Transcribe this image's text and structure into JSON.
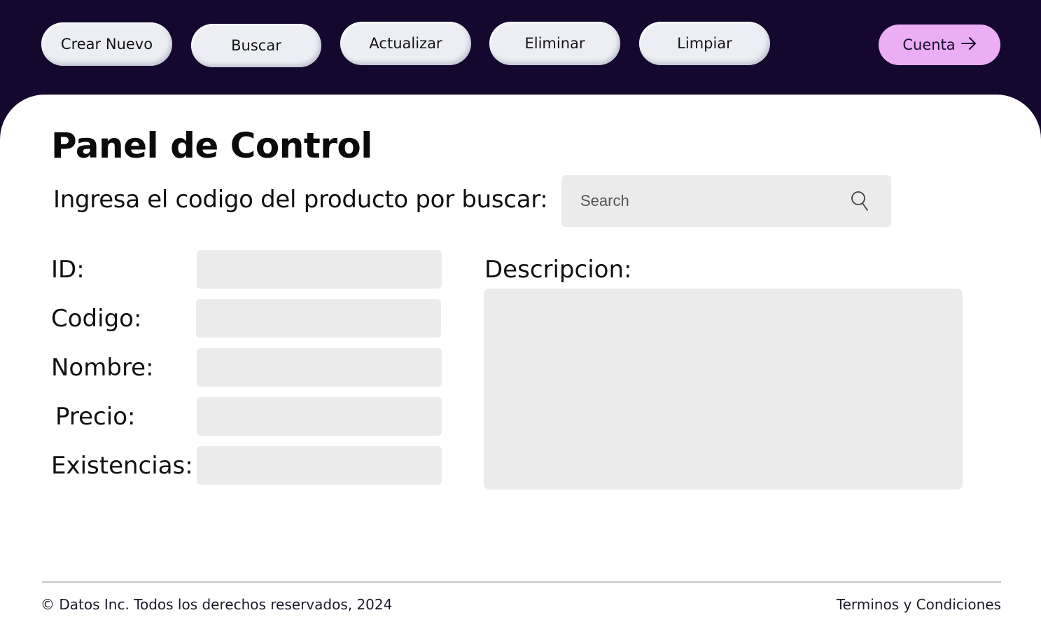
{
  "toolbar": {
    "create_label": "Crear Nuevo",
    "search_label": "Buscar",
    "update_label": "Actualizar",
    "delete_label": "Eliminar",
    "clear_label": "Limpiar",
    "account_label": "Cuenta",
    "account_icon": "arrow-right-icon"
  },
  "main": {
    "title": "Panel de Control",
    "search_prompt": "Ingresa el codigo del producto por buscar:",
    "search_placeholder": "Search",
    "search_value": "",
    "search_icon": "search-icon"
  },
  "form": {
    "id_label": "ID:",
    "id_value": "",
    "code_label": "Codigo:",
    "code_value": "",
    "name_label": "Nombre:",
    "name_value": "",
    "price_label": "Precio:",
    "price_value": "",
    "stock_label": "Existencias:",
    "stock_value": "",
    "description_label": "Descripcion:",
    "description_value": ""
  },
  "footer": {
    "copyright": "© Datos Inc. Todos los derechos reservados, 2024",
    "terms_link": "Terminos y Condiciones"
  },
  "colors": {
    "header_bg": "#14082e",
    "button_bg": "#eceef3",
    "account_bg": "#ebadf3",
    "input_bg": "#ebebeb"
  }
}
